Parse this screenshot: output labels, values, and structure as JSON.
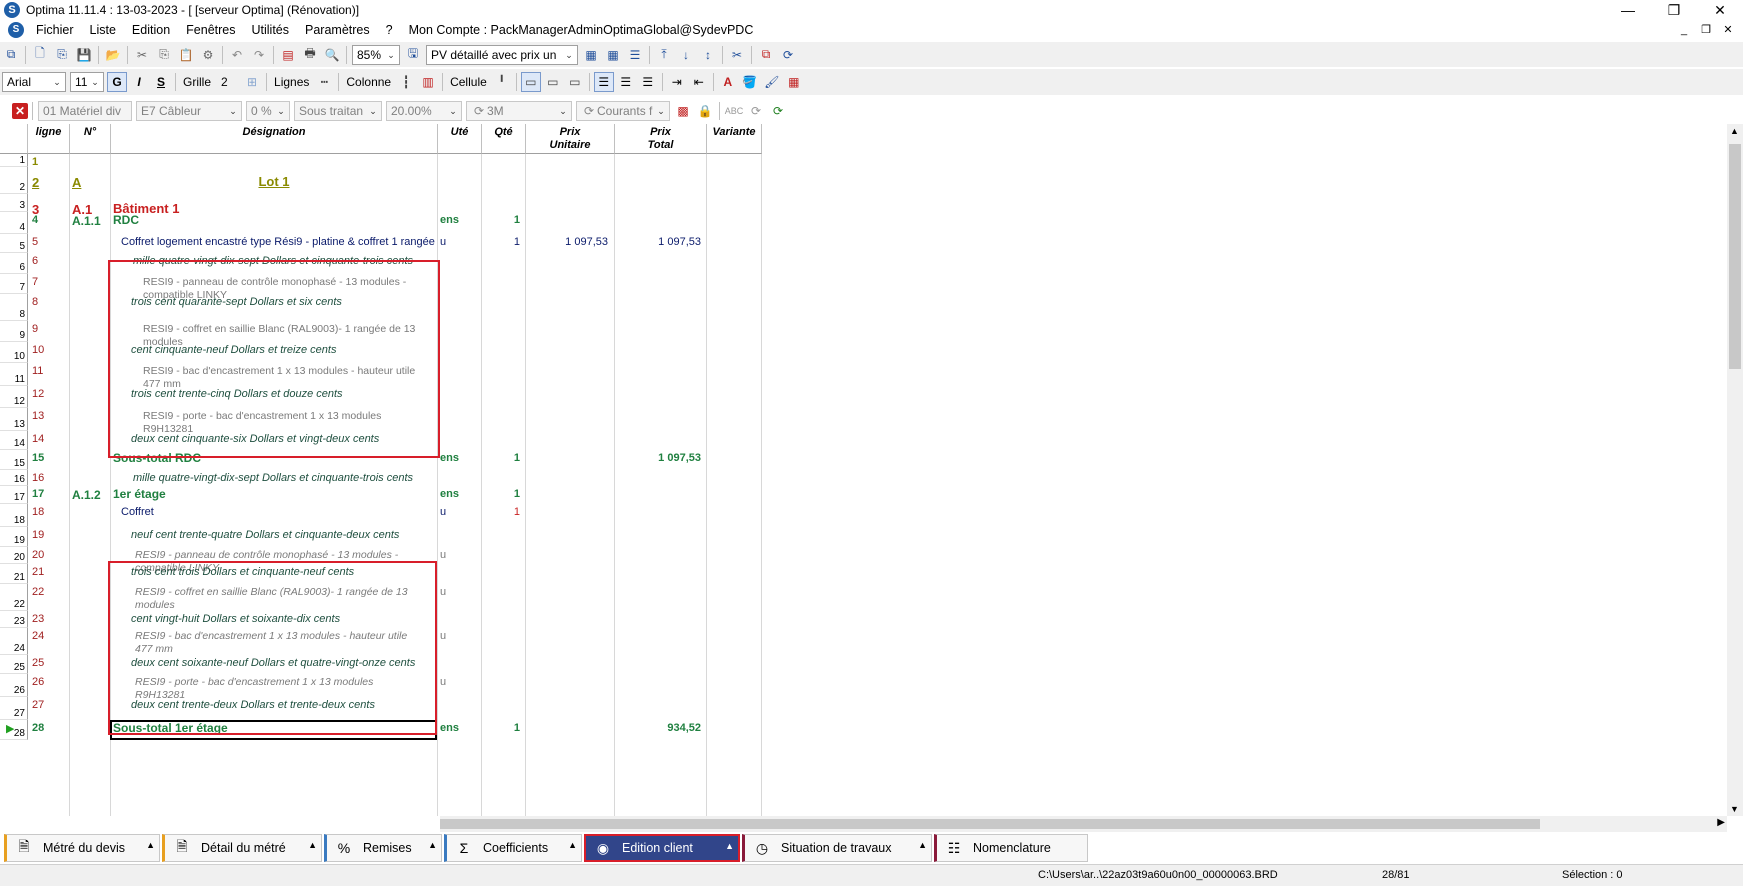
{
  "window": {
    "title": "Optima 11.11.4 : 13-03-2023 - [ [serveur Optima] (Rénovation)]"
  },
  "menu": [
    "Fichier",
    "Liste",
    "Edition",
    "Fenêtres",
    "Utilités",
    "Paramètres",
    "?",
    "Mon Compte : PackManagerAdminOptimaGlobal@SydevPDC"
  ],
  "toolbar1": {
    "zoom": "85%",
    "view": "PV détaillé avec prix un"
  },
  "toolbar2": {
    "font": "Arial",
    "size": "11",
    "bold": "G",
    "italic": "I",
    "underline": "S",
    "grille_label": "Grille",
    "grille_value": "2",
    "lignes_label": "Lignes",
    "colonne_label": "Colonne",
    "cellule_label": "Cellule"
  },
  "toolbar3": {
    "c1": "01  Matériel div",
    "c2": "E7  Câbleur",
    "c3": "0 %",
    "c4": "Sous traitan",
    "c5": "20.00%",
    "c6": "3M",
    "c7": "Courants f"
  },
  "grid": {
    "headers": {
      "ligne": "ligne",
      "num": "N°",
      "designation": "Désignation",
      "ute": "Uté",
      "qte": "Qté",
      "pu": "Prix\nUnitaire",
      "pt": "Prix\nTotal",
      "variante": "Variante"
    },
    "rows": [
      {
        "n": "1",
        "ligne": "1",
        "num": "",
        "des": "",
        "ute": "",
        "qte": "",
        "pu": "",
        "pt": ""
      },
      {
        "n": "2",
        "ligne": "2",
        "num": "A",
        "des": "Lot 1",
        "ute": "",
        "qte": "",
        "pu": "",
        "pt": ""
      },
      {
        "n": "3",
        "ligne": "3",
        "num": "A.1",
        "des": "Bâtiment 1",
        "ute": "",
        "qte": "",
        "pu": "",
        "pt": ""
      },
      {
        "n": "4",
        "ligne": "4",
        "num": "A.1.1",
        "des": "RDC",
        "ute": "ens",
        "qte": "1",
        "pu": "",
        "pt": ""
      },
      {
        "n": "5",
        "ligne": "5",
        "num": "",
        "des": "Coffret logement encastré type Rési9 - platine & coffret 1 rangée",
        "ute": "u",
        "qte": "1",
        "pu": "1 097,53",
        "pt": "1 097,53"
      },
      {
        "n": "6",
        "ligne": "6",
        "num": "",
        "des": "mille  quatre-vingt-dix-sept Dollars et cinquante-trois cents",
        "ute": "",
        "qte": "",
        "pu": "",
        "pt": ""
      },
      {
        "n": "7",
        "ligne": "7",
        "num": "",
        "des": "RESI9 - panneau de contrôle monophasé - 13 modules -",
        "des2": "compatible LINKY",
        "ute": "",
        "qte": "",
        "pu": "",
        "pt": ""
      },
      {
        "n": "8",
        "ligne": "8",
        "num": "",
        "des": "trois cent quarante-sept Dollars et six cents",
        "ute": "",
        "qte": "",
        "pu": "",
        "pt": ""
      },
      {
        "n": "9",
        "ligne": "9",
        "num": "",
        "des": "RESI9 - coffret en saillie Blanc (RAL9003)- 1 rangée de 13",
        "des2": "modules",
        "ute": "",
        "qte": "",
        "pu": "",
        "pt": ""
      },
      {
        "n": "10",
        "ligne": "10",
        "num": "",
        "des": "cent cinquante-neuf Dollars et treize cents",
        "ute": "",
        "qte": "",
        "pu": "",
        "pt": ""
      },
      {
        "n": "11",
        "ligne": "11",
        "num": "",
        "des": "RESI9 - bac d'encastrement 1 x 13 modules - hauteur utile",
        "des2": "477 mm",
        "ute": "",
        "qte": "",
        "pu": "",
        "pt": ""
      },
      {
        "n": "12",
        "ligne": "12",
        "num": "",
        "des": "trois cent trente-cinq Dollars et douze cents",
        "ute": "",
        "qte": "",
        "pu": "",
        "pt": ""
      },
      {
        "n": "13",
        "ligne": "13",
        "num": "",
        "des": "RESI9 - porte - bac d'encastrement 1 x 13 modules",
        "des2": "R9H13281",
        "ute": "",
        "qte": "",
        "pu": "",
        "pt": ""
      },
      {
        "n": "14",
        "ligne": "14",
        "num": "",
        "des": "deux cent cinquante-six Dollars et vingt-deux cents",
        "ute": "",
        "qte": "",
        "pu": "",
        "pt": ""
      },
      {
        "n": "15",
        "ligne": "15",
        "num": "",
        "des": "Sous-total RDC",
        "ute": "ens",
        "qte": "1",
        "pu": "",
        "pt": "1 097,53"
      },
      {
        "n": "16",
        "ligne": "16",
        "num": "",
        "des": "mille  quatre-vingt-dix-sept Dollars et cinquante-trois cents",
        "ute": "",
        "qte": "",
        "pu": "",
        "pt": ""
      },
      {
        "n": "17",
        "ligne": "17",
        "num": "A.1.2",
        "des": "1er étage",
        "ute": "ens",
        "qte": "1",
        "pu": "",
        "pt": ""
      },
      {
        "n": "18",
        "ligne": "18",
        "num": "",
        "des": "Coffret",
        "ute": "u",
        "qte": "1",
        "pu": "",
        "pt": ""
      },
      {
        "n": "19",
        "ligne": "19",
        "num": "",
        "des": "neuf cent trente-quatre Dollars et cinquante-deux cents",
        "ute": "",
        "qte": "",
        "pu": "",
        "pt": ""
      },
      {
        "n": "20",
        "ligne": "20",
        "num": "",
        "des": "RESI9 - panneau de contrôle monophasé - 13 modules -",
        "des2": "compatible LINKY",
        "ute": "u",
        "qte": "",
        "pu": "",
        "pt": ""
      },
      {
        "n": "21",
        "ligne": "21",
        "num": "",
        "des": "trois cent trois Dollars et cinquante-neuf cents",
        "ute": "",
        "qte": "",
        "pu": "",
        "pt": ""
      },
      {
        "n": "22",
        "ligne": "22",
        "num": "",
        "des": "RESI9 - coffret en saillie Blanc (RAL9003)- 1 rangée de 13",
        "des2": "modules",
        "ute": "u",
        "qte": "",
        "pu": "",
        "pt": ""
      },
      {
        "n": "23",
        "ligne": "23",
        "num": "",
        "des": "cent vingt-huit Dollars et  soixante-dix cents",
        "ute": "",
        "qte": "",
        "pu": "",
        "pt": ""
      },
      {
        "n": "24",
        "ligne": "24",
        "num": "",
        "des": "RESI9 - bac d'encastrement 1 x 13 modules - hauteur utile",
        "des2": "477 mm",
        "ute": "u",
        "qte": "",
        "pu": "",
        "pt": ""
      },
      {
        "n": "25",
        "ligne": "25",
        "num": "",
        "des": "deux cent soixante-neuf Dollars et  quatre-vingt-onze cents",
        "ute": "",
        "qte": "",
        "pu": "",
        "pt": ""
      },
      {
        "n": "26",
        "ligne": "26",
        "num": "",
        "des": "RESI9 - porte - bac d'encastrement 1 x 13 modules",
        "des2": "R9H13281",
        "ute": "u",
        "qte": "",
        "pu": "",
        "pt": ""
      },
      {
        "n": "27",
        "ligne": "27",
        "num": "",
        "des": "deux cent trente-deux Dollars et trente-deux cents",
        "ute": "",
        "qte": "",
        "pu": "",
        "pt": ""
      },
      {
        "n": "28",
        "ligne": "28",
        "num": "",
        "des": "Sous-total 1er étage",
        "ute": "ens",
        "qte": "1",
        "pu": "",
        "pt": "934,52"
      }
    ]
  },
  "tabs": [
    "Métré du devis",
    "Détail du métré",
    "Remises",
    "Coefficients",
    "Edition client",
    "Situation de travaux",
    "Nomenclature"
  ],
  "status": {
    "path": "C:\\Users\\ar..\\22az03t9a60u0n00_00000063.BRD",
    "position": "28/81",
    "selection": "Sélection : 0"
  }
}
